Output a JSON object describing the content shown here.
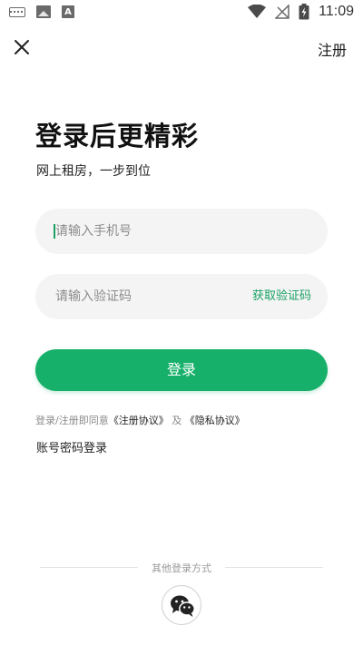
{
  "status_bar": {
    "time": "11:09",
    "left_icons": [
      "keyboard-icon",
      "image-icon",
      "a-icon"
    ],
    "right_icons": [
      "wifi-icon",
      "no-signal-icon",
      "battery-charging-icon"
    ]
  },
  "header": {
    "close_icon": "close-icon",
    "register_label": "注册"
  },
  "title": "登录后更精彩",
  "subtitle": "网上租房，一步到位",
  "form": {
    "phone_placeholder": "请输入手机号",
    "code_placeholder": "请输入验证码",
    "get_code_label": "获取验证码",
    "login_label": "登录"
  },
  "agreement": {
    "prefix": "登录/注册即同意",
    "register_protocol": "《注册协议》",
    "and": "及",
    "privacy_protocol": "《隐私协议》"
  },
  "password_login_label": "账号密码登录",
  "other_login": {
    "label": "其他登录方式",
    "wechat_icon": "wechat-icon"
  },
  "colors": {
    "accent": "#17b06a",
    "link_green": "#1aa063",
    "input_bg": "#f4f4f4"
  }
}
